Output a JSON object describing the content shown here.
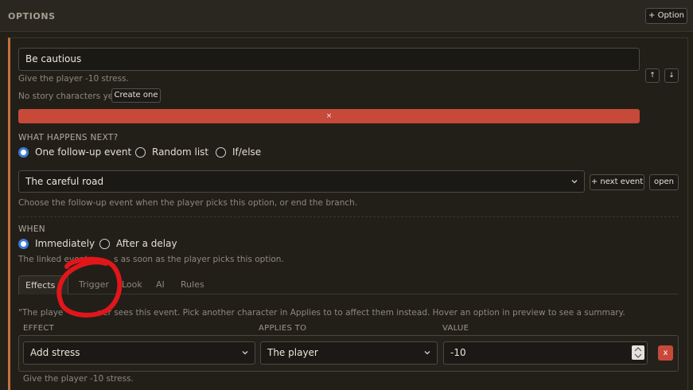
{
  "header": {
    "title": "OPTIONS",
    "add_option_label": "+ Option"
  },
  "option": {
    "text_value": "Be cautious",
    "summary": "Give the player -10 stress.",
    "no_characters": "No story characters yet.",
    "create_label": "Create one",
    "move_up": "↑",
    "move_down": "↓",
    "remove_label": "×"
  },
  "next": {
    "label": "WHAT HAPPENS NEXT?",
    "modes": [
      "One follow-up event",
      "Random list",
      "If/else"
    ],
    "selected_mode": "One follow-up event",
    "event_value": "The careful road",
    "next_event_label": "+ next event",
    "open_label": "open",
    "help": "Choose the follow-up event when the player picks this option, or end the branch."
  },
  "when": {
    "label": "WHEN",
    "modes": [
      "Immediately",
      "After a delay"
    ],
    "selected_mode": "Immediately",
    "help_start": "The linked event",
    "help_end": "s as soon as the player picks this option."
  },
  "tabs": [
    {
      "label": "Effects (",
      "active": true
    },
    {
      "label": "Trigger",
      "active": false
    },
    {
      "label": "Look",
      "active": false
    },
    {
      "label": "AI",
      "active": false
    },
    {
      "label": "Rules",
      "active": false
    }
  ],
  "effects": {
    "note_start": "\"The playe",
    "note_end": "ver sees this event. Pick another character in Applies to to affect them instead. Hover an option in preview to see a summary.",
    "col_effect": "EFFECT",
    "col_applies": "APPLIES TO",
    "col_value": "VALUE",
    "row": {
      "effect": "Add stress",
      "applies_to": "The player",
      "value": "-10",
      "delete_label": "x"
    },
    "row_summary": "Give the player -10 stress."
  },
  "colors": {
    "accent": "#c7713a",
    "danger": "#c6493a",
    "radio_checked": "#3a7bd5",
    "annotation": "#e0161b"
  }
}
